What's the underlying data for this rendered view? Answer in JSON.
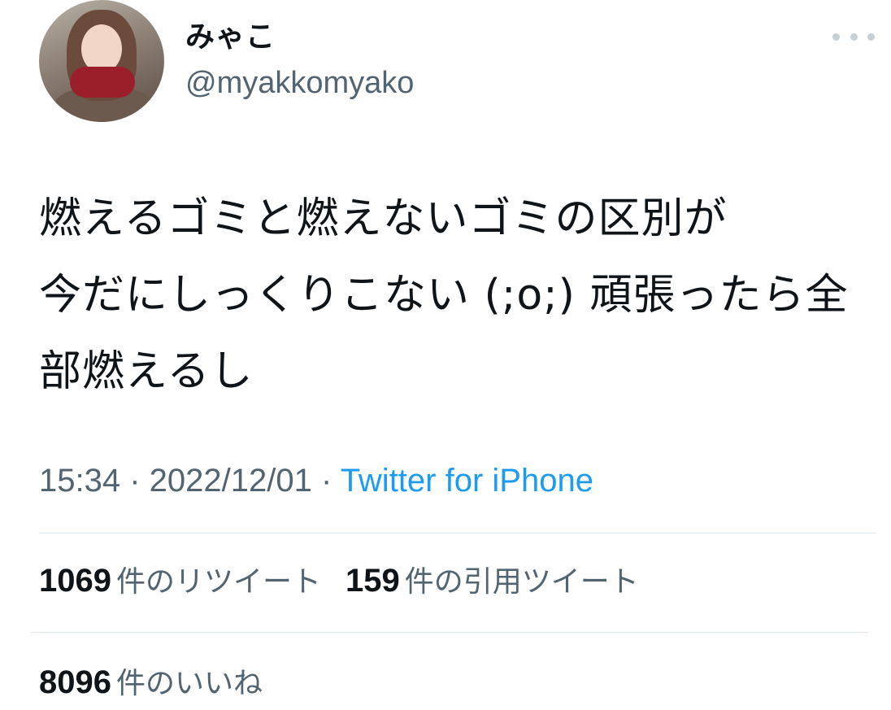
{
  "author": {
    "display_name": "みゃこ",
    "handle": "@myakkomyako"
  },
  "menu_icon": "more-horizontal-icon",
  "tweet": {
    "text": "燃えるゴミと燃えないゴミの区別が\n今だにしっくりこない (;o;) 頑張ったら全部燃えるし"
  },
  "meta": {
    "time": "15:34",
    "separator": " · ",
    "date": "2022/12/01",
    "source": "Twitter for iPhone"
  },
  "stats": {
    "retweets": {
      "count": "1069",
      "label": "件のリツイート"
    },
    "quotes": {
      "count": "159",
      "label": "件の引用ツイート"
    },
    "likes": {
      "count": "8096",
      "label": "件のいいね"
    }
  },
  "colors": {
    "text": "#0f1419",
    "secondary": "#536471",
    "link": "#1d9bf0",
    "divider": "#e1e8ed"
  }
}
